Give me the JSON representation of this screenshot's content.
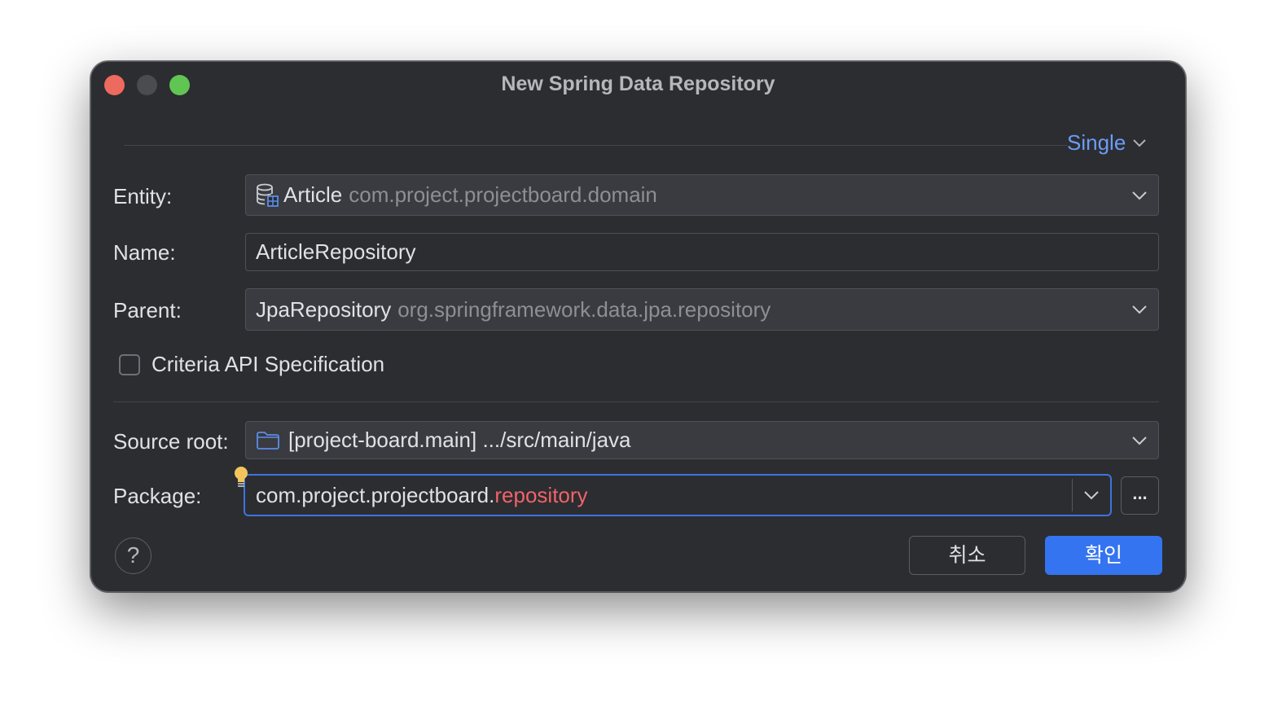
{
  "window": {
    "title": "New Spring Data Repository"
  },
  "mode": {
    "label": "Single"
  },
  "entity": {
    "label": "Entity:",
    "name": "Article",
    "package": "com.project.projectboard.domain",
    "icon": "database-entity-icon"
  },
  "name_field": {
    "label": "Name:",
    "value": "ArticleRepository"
  },
  "parent": {
    "label": "Parent:",
    "name": "JpaRepository",
    "package": "org.springframework.data.jpa.repository"
  },
  "criteria": {
    "label": "Criteria API Specification",
    "checked": false
  },
  "source_root": {
    "label": "Source root:",
    "value": "[project-board.main] .../src/main/java",
    "icon": "folder-icon"
  },
  "package_field": {
    "label": "Package:",
    "prefix": "com.project.projectboard.",
    "highlight": "repository",
    "browse_label": "..."
  },
  "buttons": {
    "help": "?",
    "cancel": "취소",
    "ok": "확인"
  },
  "colors": {
    "accent": "#3574f0",
    "link": "#6d9cf5",
    "error_text": "#f0636a",
    "close": "#ed6a5e",
    "maximize": "#61c554"
  }
}
